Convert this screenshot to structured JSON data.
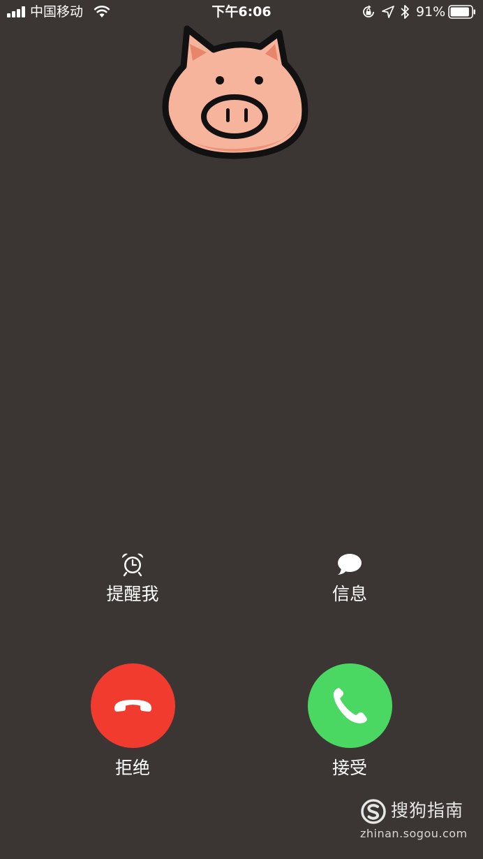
{
  "status_bar": {
    "carrier": "中国移动",
    "time": "下午6:06",
    "battery_percent": "91%",
    "battery_level": 0.91,
    "icons": [
      "signal-icon",
      "wifi-icon",
      "lock-rotation-icon",
      "location-icon",
      "bluetooth-icon",
      "battery-icon"
    ]
  },
  "caller": {
    "avatar": "pig-face-icon"
  },
  "secondary_actions": {
    "remind_label": "提醒我",
    "remind_icon": "alarm-clock-icon",
    "message_label": "信息",
    "message_icon": "speech-bubble-icon"
  },
  "call_actions": {
    "decline_label": "拒绝",
    "decline_icon": "hang-up-icon",
    "decline_color": "#f23b2f",
    "accept_label": "接受",
    "accept_icon": "phone-icon",
    "accept_color": "#4bd862"
  },
  "watermark": {
    "brand": "搜狗指南",
    "url": "zhinan.sogou.com"
  },
  "colors": {
    "background": "#3b3633",
    "pig_skin": "#f5b49b",
    "pig_outline": "#111111"
  }
}
